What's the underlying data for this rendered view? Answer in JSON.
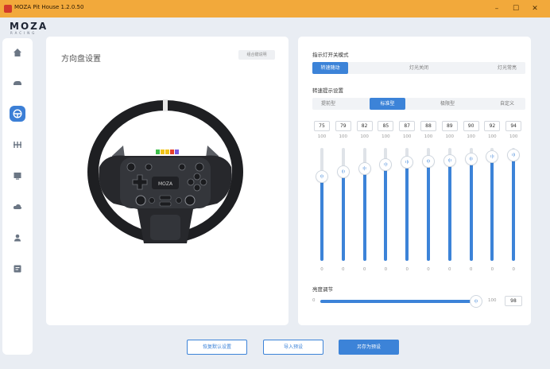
{
  "window": {
    "title": "MOZA Pit House 1.2.0.50",
    "minimize": "–",
    "maximize": "☐",
    "close": "✕"
  },
  "brand": {
    "logo": "MOZA",
    "tagline": "RACING"
  },
  "sidebar": {
    "items": [
      {
        "icon": "home-icon",
        "active": false
      },
      {
        "icon": "car-icon",
        "active": false
      },
      {
        "icon": "steering-wheel-icon",
        "active": true
      },
      {
        "icon": "pedals-icon",
        "active": false
      },
      {
        "icon": "dashboard-icon",
        "active": false
      },
      {
        "icon": "cloud-icon",
        "active": false
      },
      {
        "icon": "user-icon",
        "active": false
      },
      {
        "icon": "device-list-icon",
        "active": false
      }
    ]
  },
  "left_panel": {
    "title": "方向盘设置",
    "info_button": "组合键说明"
  },
  "right_panel": {
    "indicator_mode_title": "指示灯开关模式",
    "indicator_modes": [
      "转速随动",
      "灯光关闭",
      "灯光常亮"
    ],
    "indicator_selected": 0,
    "rpm_title": "转速提示设置",
    "rpm_modes": [
      "提前型",
      "标准型",
      "极限型",
      "自定义"
    ],
    "rpm_selected": 1,
    "sliders": {
      "values": [
        "75",
        "79",
        "82",
        "85",
        "87",
        "88",
        "89",
        "90",
        "92",
        "94"
      ],
      "max_label": "100",
      "min_label": "0",
      "thumb_glyph": "ı|ı"
    },
    "brightness": {
      "title": "亮度调节",
      "min": "0",
      "max": "100",
      "value": "98"
    }
  },
  "footer": {
    "restore_defaults": "恢复默认设置",
    "import_preset": "导入预设",
    "save_as_preset": "另存为预设"
  },
  "colors": {
    "accent": "#3c83d8",
    "titlebar": "#f2a93b",
    "background": "#e9edf3"
  }
}
